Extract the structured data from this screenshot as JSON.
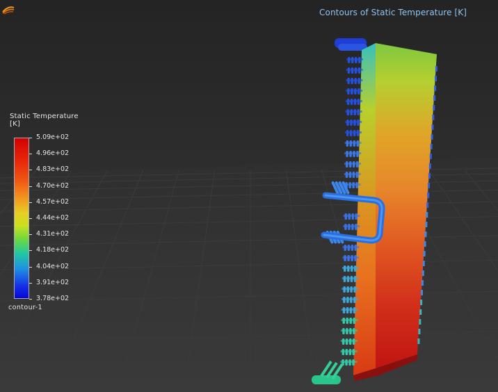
{
  "viewport": {
    "title": "Contours of Static Temperature [K]",
    "logo_icon": "fluent-logo-icon"
  },
  "legend": {
    "title": "Static Temperature",
    "units": "[K]",
    "footer": "contour-1",
    "labels": [
      "5.09e+02",
      "4.96e+02",
      "4.83e+02",
      "4.70e+02",
      "4.57e+02",
      "4.44e+02",
      "4.31e+02",
      "4.18e+02",
      "4.04e+02",
      "3.91e+02",
      "3.78e+02"
    ],
    "colors": {
      "max": "#d40000",
      "high": "#f05a14",
      "mid": "#e6cf24",
      "midlow": "#22c8a0",
      "low": "#1e8ee4",
      "min": "#0707d6"
    }
  },
  "scene": {
    "background": "#262626",
    "grid_color": "#3a3a3a"
  }
}
